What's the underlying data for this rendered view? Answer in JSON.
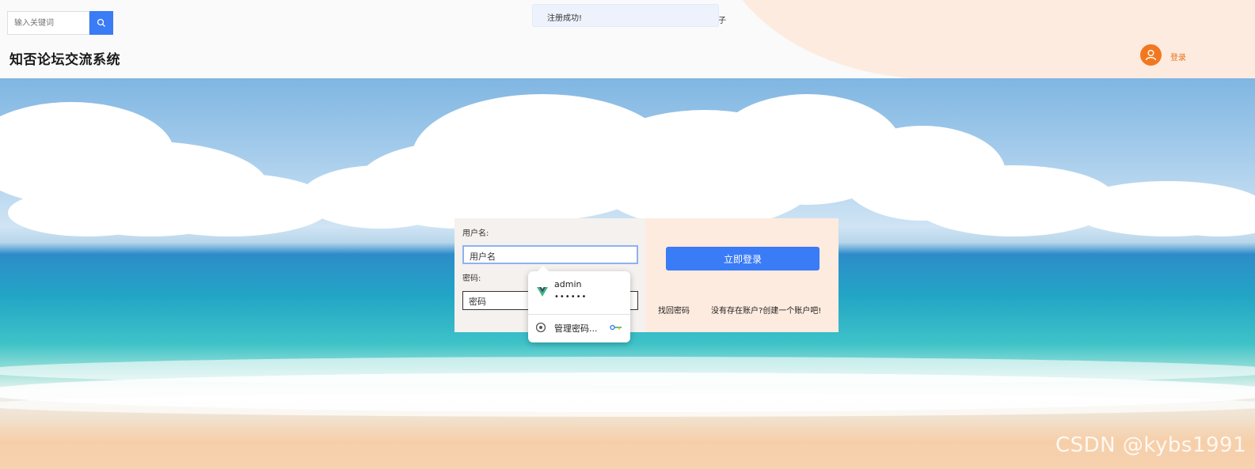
{
  "header": {
    "search_placeholder": "输入关键词",
    "site_title": "知否论坛交流系统",
    "login_label": "登录"
  },
  "toast": {
    "message": "注册成功!",
    "clipped_text": "子"
  },
  "login_form": {
    "username_label": "用户名:",
    "username_value": "用户名",
    "password_label": "密码:",
    "password_value": "密码",
    "submit_label": "立即登录",
    "forgot_link": "找回密码",
    "register_link": "没有存在账户?创建一个账户吧!"
  },
  "autocomplete": {
    "username": "admin",
    "password_mask": "••••••",
    "manage_label": "管理密码..."
  },
  "watermark": "CSDN @kybs1991",
  "colors": {
    "primary": "#3a7bf6",
    "accent_orange": "#f2781f",
    "peach": "#feebdf"
  }
}
